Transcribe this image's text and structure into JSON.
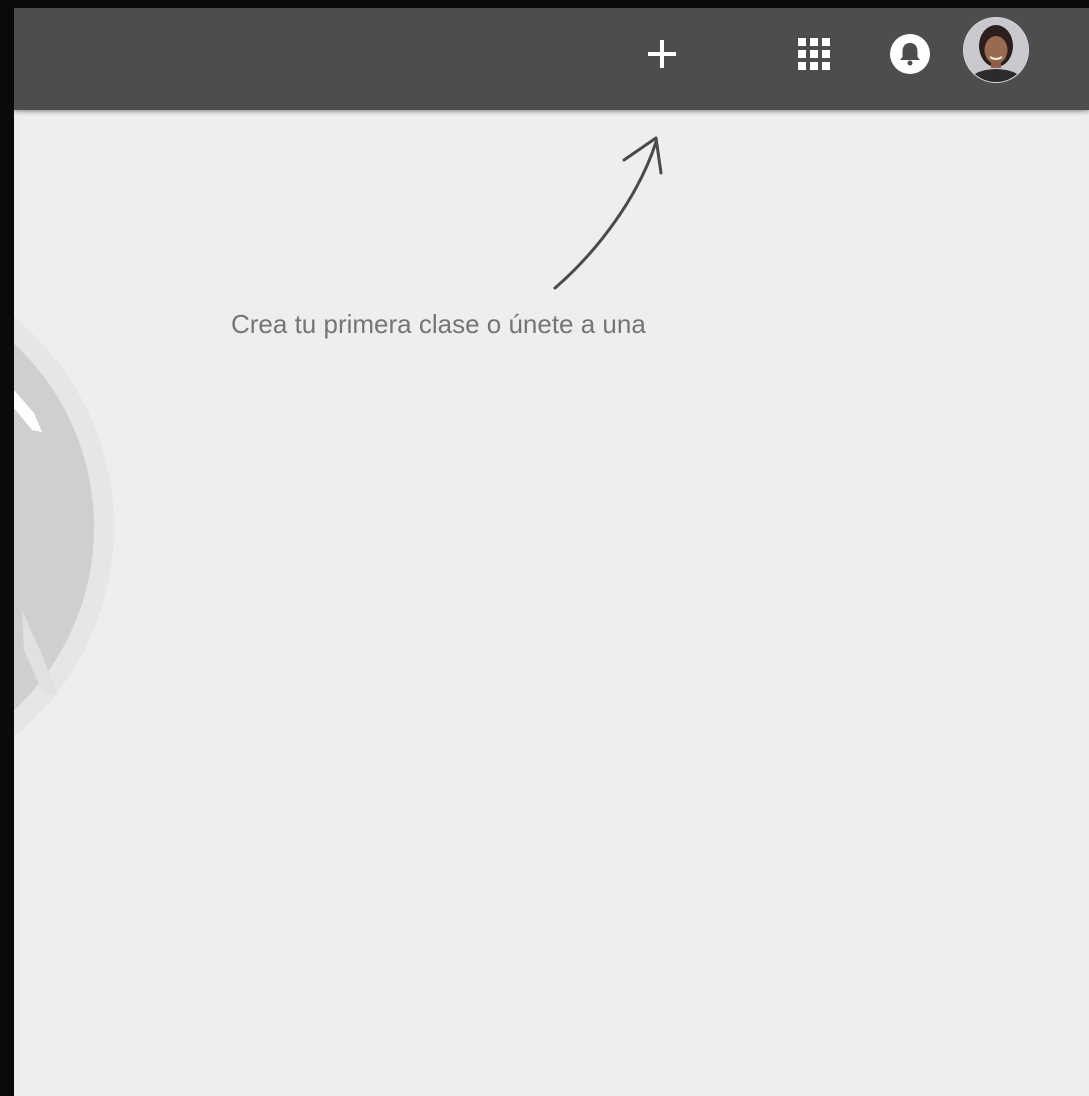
{
  "header": {
    "add_icon": "plus-icon",
    "apps_icon": "apps-grid-icon",
    "notifications_icon": "bell-icon",
    "avatar": "user-avatar"
  },
  "empty_state": {
    "hint_text": "Crea tu primera clase o únete a una"
  },
  "colors": {
    "topbar": "#4d4d4d",
    "background": "#eeeeee",
    "hint_text": "#757575",
    "frame": "#0a0a0a"
  }
}
